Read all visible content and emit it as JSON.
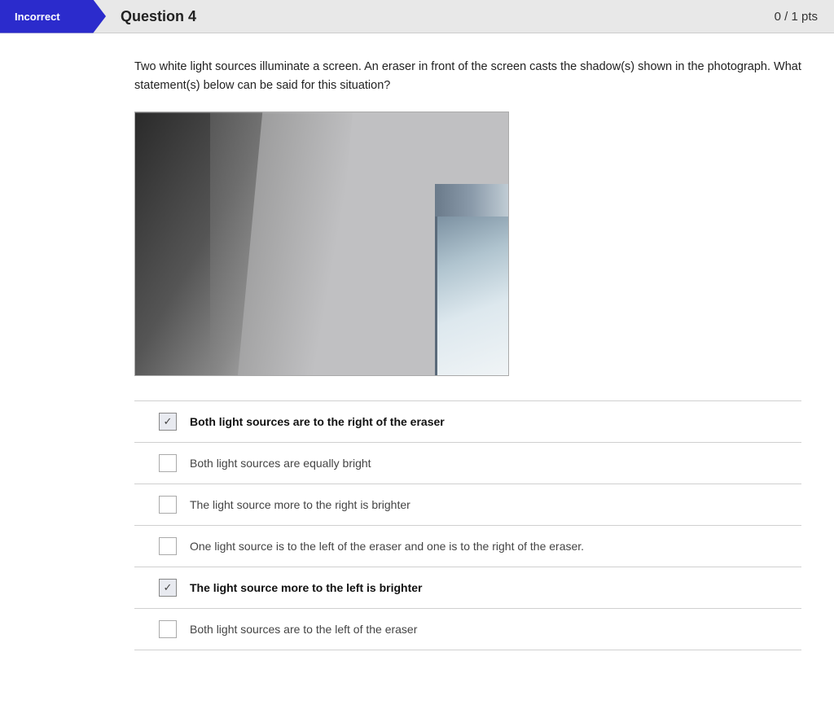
{
  "header": {
    "incorrect_label": "Incorrect",
    "question_title": "Question 4",
    "pts_label": "0 / 1 pts"
  },
  "question": {
    "text": "Two white light sources illuminate a screen. An eraser in front of the screen casts the shadow(s) shown in the photograph. What statement(s) below can be said for this situation?"
  },
  "options": [
    {
      "id": "opt1",
      "label": "Both light sources are to the right of the eraser",
      "checked": true,
      "bold": true
    },
    {
      "id": "opt2",
      "label": "Both light sources are equally bright",
      "checked": false,
      "bold": false
    },
    {
      "id": "opt3",
      "label": "The light source more to the right is brighter",
      "checked": false,
      "bold": false
    },
    {
      "id": "opt4",
      "label": "One light source is to the left of the eraser and one is to the right of the eraser.",
      "checked": false,
      "bold": false
    },
    {
      "id": "opt5",
      "label": "The light source more to the left is brighter",
      "checked": true,
      "bold": true
    },
    {
      "id": "opt6",
      "label": "Both light sources are to the left of the eraser",
      "checked": false,
      "bold": false
    }
  ]
}
